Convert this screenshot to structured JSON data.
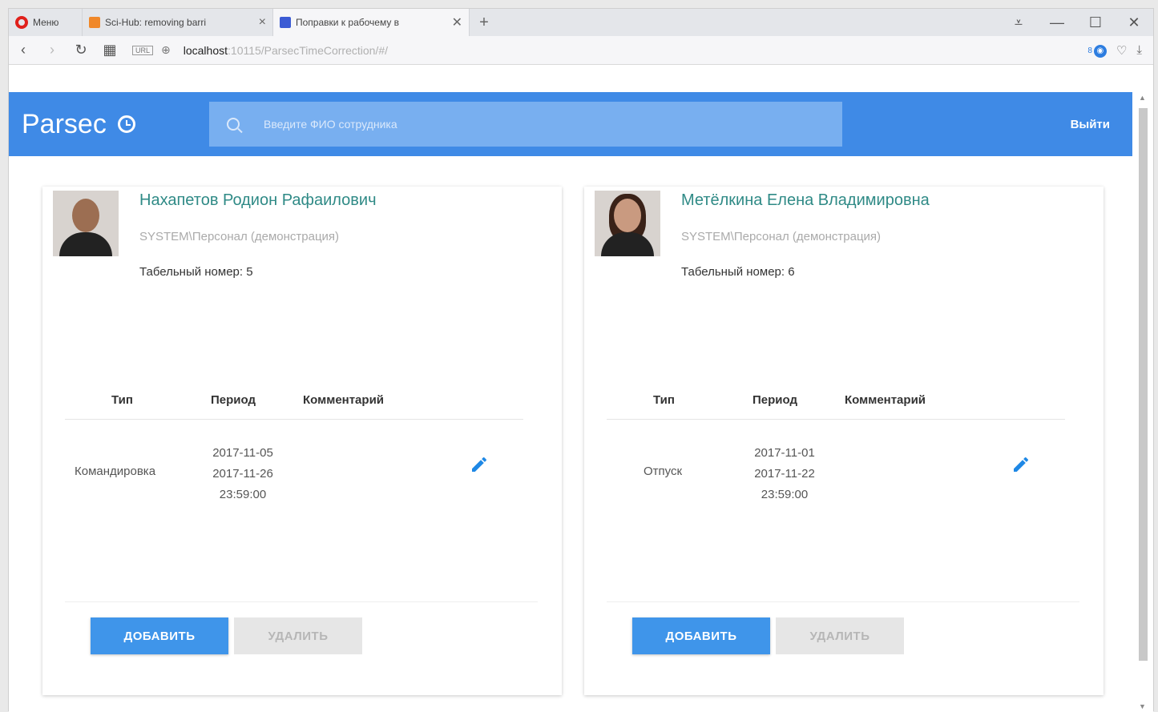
{
  "browser": {
    "tabs": [
      {
        "label": "Меню"
      },
      {
        "label": "Sci-Hub: removing barri"
      },
      {
        "label": "Поправки к рабочему в"
      }
    ],
    "url": {
      "host": "localhost",
      "path": ":10115/ParsecTimeCorrection/#/"
    },
    "url_badge": "URL",
    "adblock_count": "8"
  },
  "app": {
    "title": "Parsec",
    "search_placeholder": "Введите ФИО сотрудника",
    "logout_label": "Выйти"
  },
  "table_headers": {
    "type": "Тип",
    "period": "Период",
    "comment": "Комментарий"
  },
  "buttons": {
    "add": "ДОБАВИТЬ",
    "delete": "УДАЛИТЬ"
  },
  "employees": [
    {
      "name": "Нахапетов Родион Рафаилович",
      "department": "SYSTEM\\Персонал (демонстрация)",
      "tab_number": "Табельный номер: 5",
      "rows": [
        {
          "type": "Командировка",
          "period_start": "2017-11-05",
          "period_end": "2017-11-26",
          "period_time": "23:59:00",
          "comment": ""
        }
      ]
    },
    {
      "name": "Метёлкина Елена Владимировна",
      "department": "SYSTEM\\Персонал (демонстрация)",
      "tab_number": "Табельный номер: 6",
      "rows": [
        {
          "type": "Отпуск",
          "period_start": "2017-11-01",
          "period_end": "2017-11-22",
          "period_time": "23:59:00",
          "comment": ""
        }
      ]
    }
  ],
  "colors": {
    "primary": "#3f8ae6",
    "name": "#2f8a86",
    "button": "#3f95ea",
    "edit_icon": "#1e88e5"
  }
}
